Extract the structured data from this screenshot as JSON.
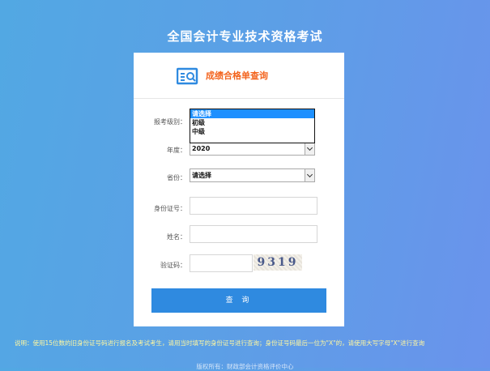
{
  "page": {
    "title": "全国会计专业技术资格考试",
    "note": "说明：使用15位数的旧身份证号码进行报名及考试考生，请用当时填写的身份证号进行查询；身份证号码最后一位为\"X\"的，请使用大写字母\"X\"进行查询",
    "footer": "版权所有：财政部会计资格评价中心"
  },
  "card": {
    "title": "成绩合格单查询",
    "icon": "query-document-icon"
  },
  "form": {
    "level": {
      "label": "报考级别：",
      "options": [
        "请选择",
        "初级",
        "中级"
      ],
      "selected": "请选择"
    },
    "year": {
      "label": "年度：",
      "value": "2020"
    },
    "province": {
      "label": "省份：",
      "value": "请选择"
    },
    "id_number": {
      "label": "身份证号：",
      "value": ""
    },
    "name": {
      "label": "姓名：",
      "value": ""
    },
    "captcha": {
      "label": "验证码：",
      "value": "",
      "code": "9319"
    },
    "submit_label": "查 询"
  },
  "colors": {
    "background_start": "#52a8e3",
    "background_end": "#6a93ec",
    "accent": "#f3641e",
    "button": "#2f8ae0",
    "note": "#fff7a0"
  }
}
